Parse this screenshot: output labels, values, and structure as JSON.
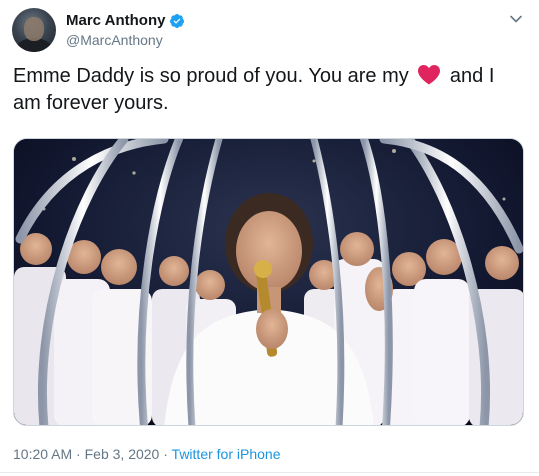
{
  "author": {
    "display_name": "Marc Anthony",
    "handle": "@MarcAnthony",
    "verified": true
  },
  "tweet": {
    "text_before_emoji": "Emme Daddy is so proud of you. You are my",
    "emoji": "red-heart",
    "text_after_emoji": "and I am forever yours."
  },
  "meta": {
    "time": "10:20 AM",
    "sep1": " · ",
    "date": "Feb 3, 2020",
    "sep2": " · ",
    "source": "Twitter for iPhone"
  },
  "colors": {
    "text": "#14171a",
    "secondary": "#657786",
    "link": "#1b95e0",
    "verified": "#1da1f2",
    "heart": "#e0245e"
  }
}
